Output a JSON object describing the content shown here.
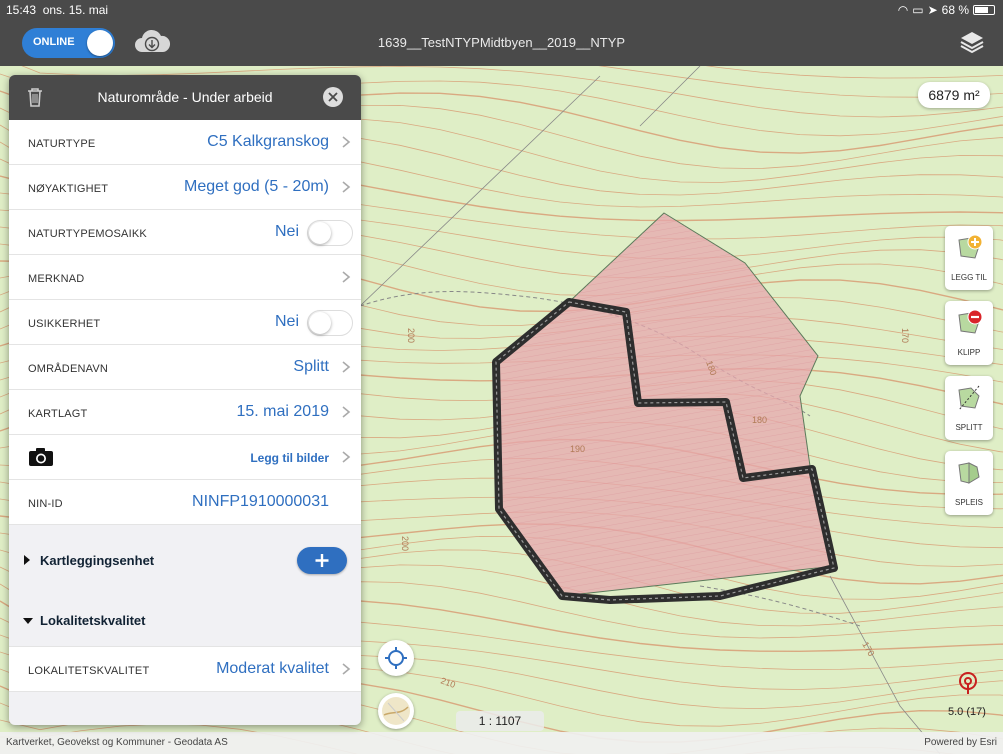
{
  "status_bar": {
    "time": "15:43",
    "date": "ons. 15. mai",
    "battery": "68 %"
  },
  "toolbar": {
    "online_label": "ONLINE",
    "project_title": "1639__TestNTYPMidtbyen__2019__NTYP"
  },
  "map": {
    "area": "6879 m²",
    "scale": "1 : 1107",
    "gps_accuracy": "5.0 (17)",
    "contour_labels": [
      "190",
      "180",
      "180",
      "170",
      "200",
      "200",
      "170",
      "210",
      "220"
    ],
    "attribution": "Kartverket, Geovekst og Kommuner - Geodata AS",
    "powered_by": "Powered by Esri",
    "colors": {
      "base": "#dfeec6",
      "contour": "#d9a27a",
      "polygon_fill": "#e7a7ad",
      "polygon_edge": "#333333"
    }
  },
  "tools": [
    {
      "label": "LEGG TIL",
      "icon": "add-area-icon"
    },
    {
      "label": "KLIPP",
      "icon": "clip-area-icon"
    },
    {
      "label": "SPLITT",
      "icon": "split-area-icon"
    },
    {
      "label": "SPLEIS",
      "icon": "merge-area-icon"
    }
  ],
  "panel": {
    "title": "Naturområde - Under arbeid",
    "rows": [
      {
        "key": "NATURTYPE",
        "value": "C5 Kalkgranskog"
      },
      {
        "key": "NØYAKTIGHET",
        "value": "Meget god (5 - 20m)"
      },
      {
        "key": "NATURTYPEMOSAIKK",
        "value": "Nei"
      },
      {
        "key": "MERKNAD",
        "value": ""
      },
      {
        "key": "USIKKERHET",
        "value": "Nei"
      },
      {
        "key": "OMRÅDENAVN",
        "value": "Splitt"
      },
      {
        "key": "KARTLAGT",
        "value": "15. mai 2019"
      },
      {
        "key": "",
        "value": "Legg til bilder"
      },
      {
        "key": "NIN-ID",
        "value": "NINFP1910000031"
      }
    ],
    "section_kartlegging": "Kartleggingsenhet",
    "section_lokalitet": "Lokalitetskvalitet",
    "lokalitet_row": {
      "key": "LOKALITETSKVALITET",
      "value": "Moderat kvalitet"
    }
  }
}
